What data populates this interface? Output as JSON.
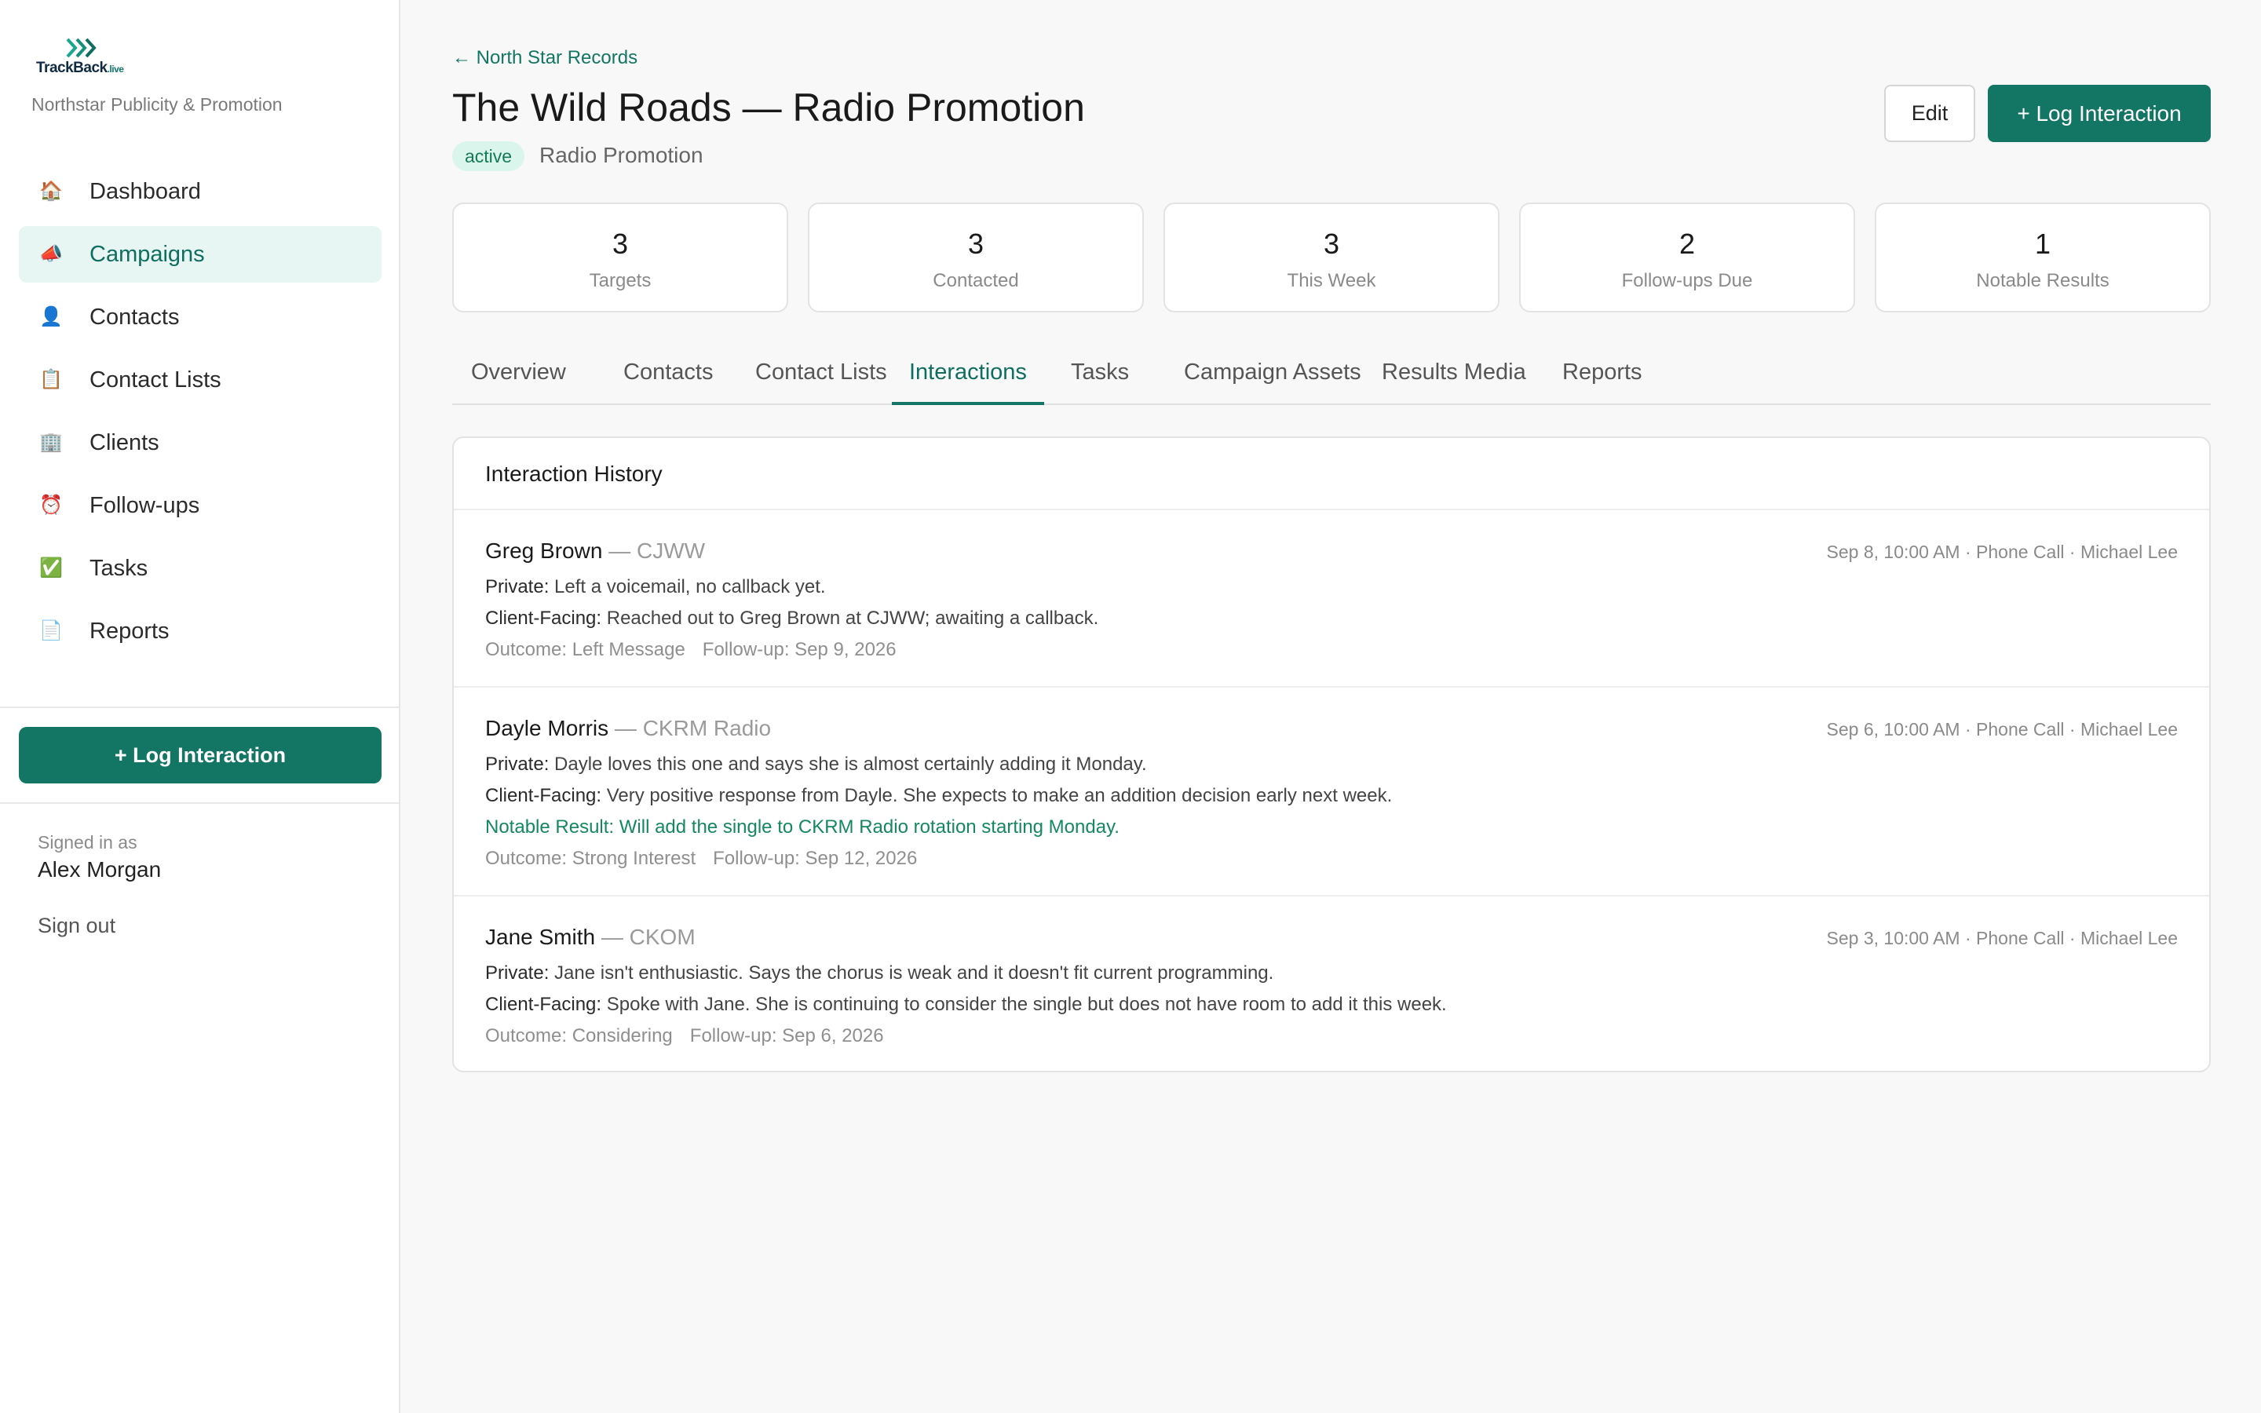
{
  "brand": {
    "logo_text": "TrackBack",
    "logo_suffix": ".live",
    "org": "Northstar Publicity & Promotion"
  },
  "sidebar": {
    "items": [
      {
        "label": "Dashboard",
        "icon": "house-icon",
        "glyph": "🏠"
      },
      {
        "label": "Campaigns",
        "icon": "megaphone-icon",
        "glyph": "📣"
      },
      {
        "label": "Contacts",
        "icon": "person-icon",
        "glyph": "👤"
      },
      {
        "label": "Contact Lists",
        "icon": "clipboard-icon",
        "glyph": "📋"
      },
      {
        "label": "Clients",
        "icon": "building-icon",
        "glyph": "🏢"
      },
      {
        "label": "Follow-ups",
        "icon": "alarm-clock-icon",
        "glyph": "⏰"
      },
      {
        "label": "Tasks",
        "icon": "check-box-icon",
        "glyph": "✅"
      },
      {
        "label": "Reports",
        "icon": "document-icon",
        "glyph": "📄"
      }
    ],
    "active_item": "Campaigns",
    "log_button": "+ Log Interaction",
    "signed_in_label": "Signed in as",
    "user_name": "Alex Morgan",
    "sign_out": "Sign out"
  },
  "header": {
    "back_link": "← North Star Records",
    "title": "The Wild Roads — Radio Promotion",
    "status": "active",
    "type": "Radio Promotion",
    "edit_label": "Edit",
    "log_label": "+ Log Interaction"
  },
  "stats": [
    {
      "value": "3",
      "label": "Targets"
    },
    {
      "value": "3",
      "label": "Contacted"
    },
    {
      "value": "3",
      "label": "This Week"
    },
    {
      "value": "2",
      "label": "Follow-ups Due"
    },
    {
      "value": "1",
      "label": "Notable Results"
    }
  ],
  "tabs": [
    "Overview",
    "Contacts",
    "Contact Lists",
    "Interactions",
    "Tasks",
    "Campaign Assets",
    "Results Media",
    "Reports"
  ],
  "active_tab": "Interactions",
  "history": {
    "title": "Interaction History",
    "entries": [
      {
        "name": "Greg Brown",
        "station": "— CJWW",
        "meta": "Sep 8, 10:00 AM · Phone Call · Michael Lee",
        "private_key": "Private:",
        "private": "Left a voicemail, no callback yet.",
        "client_key": "Client-Facing:",
        "client": "Reached out to Greg Brown at CJWW; awaiting a callback.",
        "outcome": "Outcome: Left Message",
        "followup": "Follow-up: Sep 9, 2026"
      },
      {
        "name": "Dayle Morris",
        "station": "— CKRM Radio",
        "meta": "Sep 6, 10:00 AM · Phone Call · Michael Lee",
        "private_key": "Private:",
        "private": "Dayle loves this one and says she is almost certainly adding it Monday.",
        "client_key": "Client-Facing:",
        "client": "Very positive response from Dayle. She expects to make an addition decision early next week.",
        "notable_key": "Notable Result:",
        "notable": "Will add the single to CKRM Radio rotation starting Monday.",
        "outcome": "Outcome: Strong Interest",
        "followup": "Follow-up: Sep 12, 2026"
      },
      {
        "name": "Jane Smith",
        "station": "— CKOM",
        "meta": "Sep 3, 10:00 AM · Phone Call · Michael Lee",
        "private_key": "Private:",
        "private": "Jane isn't enthusiastic. Says the chorus is weak and it doesn't fit current programming.",
        "client_key": "Client-Facing:",
        "client": "Spoke with Jane. She is continuing to consider the single but does not have room to add it this week.",
        "outcome": "Outcome: Considering",
        "followup": "Follow-up: Sep 6, 2026"
      }
    ]
  },
  "colors": {
    "accent": "#137563",
    "accent_text": "#0f6e60",
    "notable": "#14885e",
    "badge_bg": "#d9f5ec"
  }
}
